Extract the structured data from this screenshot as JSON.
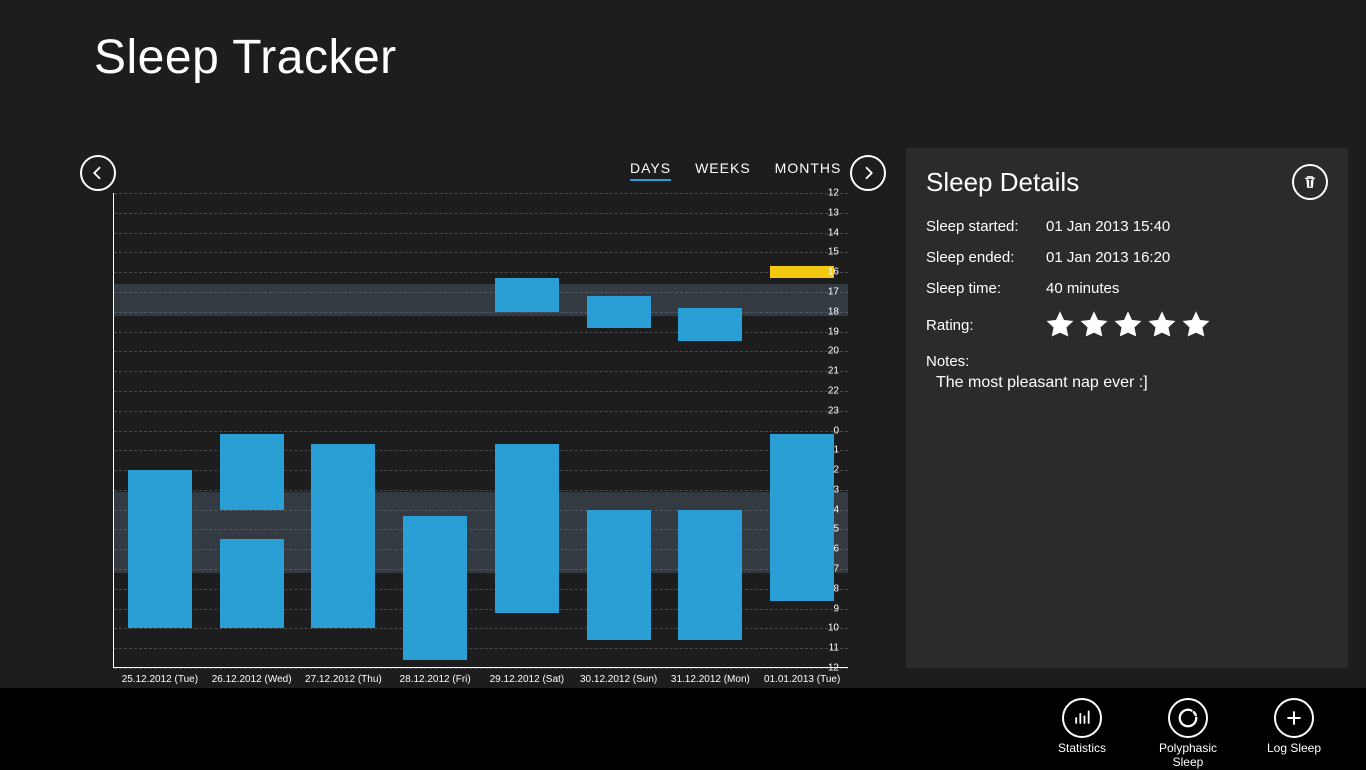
{
  "app": {
    "title": "Sleep Tracker"
  },
  "tabs": {
    "days": "DAYS",
    "weeks": "WEEKS",
    "months": "MONTHS",
    "active": "days"
  },
  "chart_data": {
    "type": "range-bar",
    "y_ticks": [
      12,
      13,
      14,
      15,
      16,
      17,
      18,
      19,
      20,
      21,
      22,
      23,
      0,
      1,
      2,
      3,
      4,
      5,
      6,
      7,
      8,
      9,
      10,
      11,
      12
    ],
    "bands": [
      {
        "from_idx": 4.6,
        "to_idx": 6.2
      },
      {
        "from_idx": 15.1,
        "to_idx": 19.2
      }
    ],
    "days": [
      {
        "label": "25.12.2012 (Tue)",
        "segments": [
          {
            "from_idx": 14.0,
            "to_idx": 22.0
          }
        ]
      },
      {
        "label": "26.12.2012 (Wed)",
        "segments": [
          {
            "from_idx": 12.2,
            "to_idx": 16.0
          },
          {
            "from_idx": 17.5,
            "to_idx": 22.0
          }
        ]
      },
      {
        "label": "27.12.2012 (Thu)",
        "segments": [
          {
            "from_idx": 12.7,
            "to_idx": 22.0
          }
        ]
      },
      {
        "label": "28.12.2012 (Fri)",
        "segments": [
          {
            "from_idx": 16.3,
            "to_idx": 23.6
          }
        ]
      },
      {
        "label": "29.12.2012 (Sat)",
        "segments": [
          {
            "from_idx": 4.3,
            "to_idx": 6.0
          },
          {
            "from_idx": 12.7,
            "to_idx": 21.2
          }
        ]
      },
      {
        "label": "30.12.2012 (Sun)",
        "segments": [
          {
            "from_idx": 5.2,
            "to_idx": 6.8
          },
          {
            "from_idx": 16.0,
            "to_idx": 22.6
          }
        ]
      },
      {
        "label": "31.12.2012 (Mon)",
        "segments": [
          {
            "from_idx": 5.8,
            "to_idx": 7.5
          },
          {
            "from_idx": 16.0,
            "to_idx": 22.6
          }
        ]
      },
      {
        "label": "01.01.2013 (Tue)",
        "segments": [
          {
            "from_idx": 3.7,
            "to_idx": 4.3,
            "selected": true
          },
          {
            "from_idx": 12.2,
            "to_idx": 20.6
          }
        ]
      }
    ]
  },
  "details": {
    "title": "Sleep Details",
    "labels": {
      "started": "Sleep started:",
      "ended": "Sleep ended:",
      "time": "Sleep time:",
      "rating": "Rating:",
      "notes": "Notes:"
    },
    "values": {
      "started": "01 Jan 2013 15:40",
      "ended": "01 Jan 2013 16:20",
      "time": "40 minutes",
      "rating": 5,
      "notes": "The most pleasant nap ever :]"
    }
  },
  "appbar": {
    "statistics": "Statistics",
    "polyphasic": "Polyphasic Sleep",
    "log": "Log Sleep"
  }
}
